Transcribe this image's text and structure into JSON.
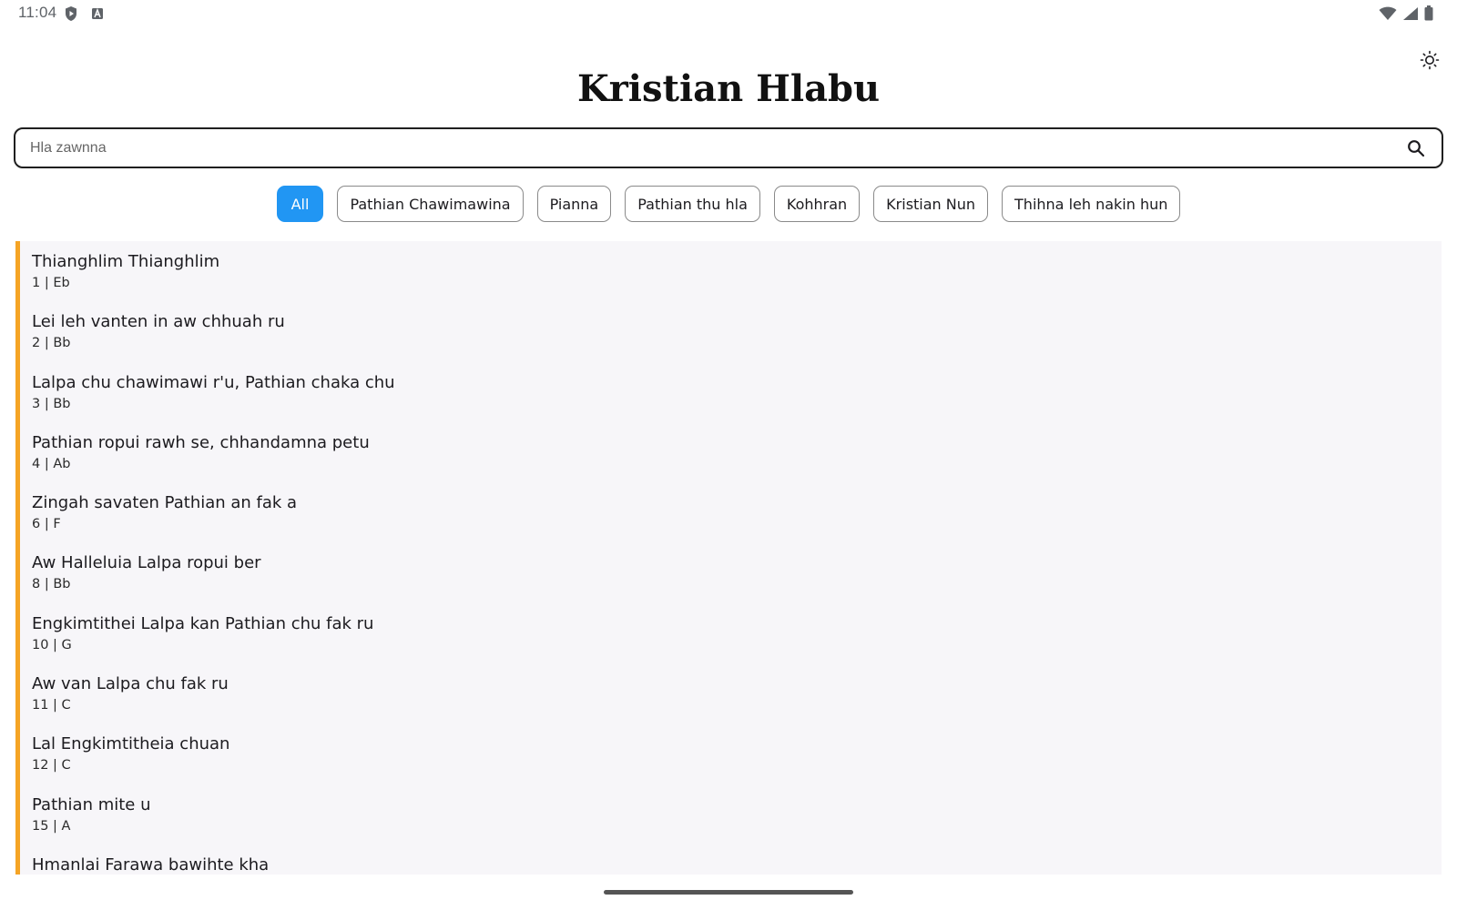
{
  "status_bar": {
    "time": "11:04",
    "left_icons": [
      "shield-icon",
      "keyboard-a-icon"
    ],
    "right_icons": [
      "wifi-icon",
      "signal-icon",
      "battery-icon"
    ]
  },
  "header": {
    "title": "Kristian Hlabu",
    "theme_toggle_icon": "sun-icon"
  },
  "search": {
    "placeholder": "Hla zawnna",
    "value": "",
    "icon": "search-icon"
  },
  "filters": [
    {
      "label": "All",
      "selected": true
    },
    {
      "label": "Pathian Chawimawina",
      "selected": false
    },
    {
      "label": "Pianna",
      "selected": false
    },
    {
      "label": "Pathian thu hla",
      "selected": false
    },
    {
      "label": "Kohhran",
      "selected": false
    },
    {
      "label": "Kristian Nun",
      "selected": false
    },
    {
      "label": "Thihna leh nakin hun",
      "selected": false
    }
  ],
  "songs": [
    {
      "title": "Thianghlim Thianghlim",
      "meta": "1 | Eb"
    },
    {
      "title": "Lei leh vanten in aw chhuah ru",
      "meta": "2 | Bb"
    },
    {
      "title": "Lalpa chu chawimawi r'u, Pathian chaka chu",
      "meta": "3 | Bb"
    },
    {
      "title": "Pathian ropui rawh se, chhandamna petu",
      "meta": "4 | Ab"
    },
    {
      "title": "Zingah savaten Pathian an fak a",
      "meta": "6 | F"
    },
    {
      "title": "Aw Halleluia Lalpa ropui ber",
      "meta": "8 | Bb"
    },
    {
      "title": "Engkimtithei Lalpa kan Pathian chu fak ru",
      "meta": "10 | G"
    },
    {
      "title": "Aw van Lalpa chu fak ru",
      "meta": "11 | C"
    },
    {
      "title": "Lal Engkimtitheia chuan",
      "meta": "12 | C"
    },
    {
      "title": "Pathian mite u",
      "meta": "15 | A"
    },
    {
      "title": "Hmanlai Farawa bawihte kha",
      "meta": ""
    }
  ],
  "colors": {
    "accent": "#2196f3",
    "list_accent_bar": "#f5a425",
    "list_background": "#f7f6f9"
  }
}
